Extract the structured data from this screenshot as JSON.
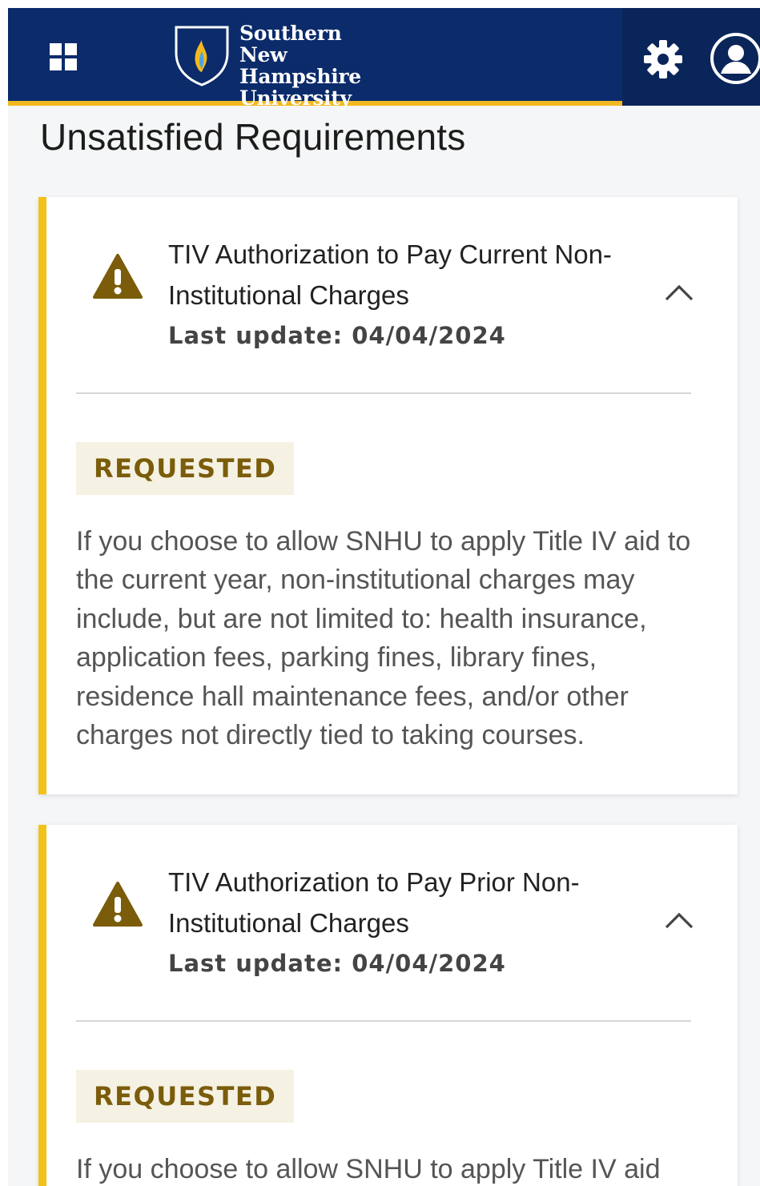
{
  "header": {
    "logo_lines": [
      "Southern",
      "New Hampshire",
      "University"
    ],
    "icons": {
      "apps": "apps-grid-icon",
      "settings": "gear-icon",
      "account": "user-avatar-icon"
    },
    "colors": {
      "navy": "#0b2b6b",
      "gold": "#f2b81f"
    }
  },
  "page_title": "Unsatisfied Requirements",
  "requirements": [
    {
      "title": "TIV Authorization to Pay Current Non-Institutional Charges",
      "last_update": "Last update: 04/04/2024",
      "status": "REQUESTED",
      "expanded": true,
      "description": "If you choose to allow SNHU to apply Title IV aid to the current year, non-institutional charges may include, but are not limited to: health insurance, application fees, parking fines, library fines, residence hall maintenance fees, and/or other charges not directly tied to taking courses."
    },
    {
      "title": "TIV Authorization to Pay Prior Non-Institutional Charges",
      "last_update": "Last update: 04/04/2024",
      "status": "REQUESTED",
      "expanded": true,
      "description": "If you choose to allow SNHU to apply Title IV aid"
    }
  ],
  "colors": {
    "accent": "#f2c21b",
    "warning": "#7a5c0a",
    "badge_bg": "#f5f1e3"
  }
}
